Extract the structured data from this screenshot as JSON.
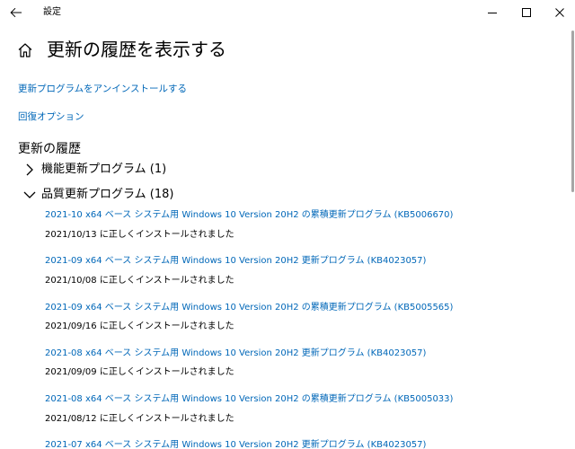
{
  "window": {
    "title": "設定"
  },
  "header": {
    "title": "更新の履歴を表示する"
  },
  "links": {
    "uninstall": "更新プログラムをアンインストールする",
    "recovery": "回復オプション"
  },
  "section": {
    "title": "更新の履歴"
  },
  "groups": [
    {
      "label": "機能更新プログラム (1)",
      "expanded": false
    },
    {
      "label": "品質更新プログラム (18)",
      "expanded": true
    }
  ],
  "updates": [
    {
      "title": "2021-10 x64 ベース システム用 Windows 10 Version 20H2 の累積更新プログラム (KB5006670)",
      "status": "2021/10/13 に正しくインストールされました"
    },
    {
      "title": "2021-09 x64 ベース システム用 Windows 10 Version 20H2 更新プログラム (KB4023057)",
      "status": "2021/10/08 に正しくインストールされました"
    },
    {
      "title": "2021-09 x64 ベース システム用 Windows 10 Version 20H2 の累積更新プログラム (KB5005565)",
      "status": "2021/09/16 に正しくインストールされました"
    },
    {
      "title": "2021-08 x64 ベース システム用 Windows 10 Version 20H2 更新プログラム (KB4023057)",
      "status": "2021/09/09 に正しくインストールされました"
    },
    {
      "title": "2021-08 x64 ベース システム用 Windows 10 Version 20H2 の累積更新プログラム (KB5005033)",
      "status": "2021/08/12 に正しくインストールされました"
    },
    {
      "title": "2021-07 x64 ベース システム用 Windows 10 Version 20H2 更新プログラム (KB4023057)",
      "status": ""
    }
  ],
  "colors": {
    "link": "#0067b8",
    "text": "#000000",
    "background": "#ffffff"
  },
  "icons": {
    "back": "back-arrow-icon",
    "home": "home-icon",
    "minimize": "minimize-icon",
    "maximize": "maximize-icon",
    "close": "close-icon",
    "collapsed": "chevron-right-icon",
    "expanded": "chevron-down-icon"
  }
}
